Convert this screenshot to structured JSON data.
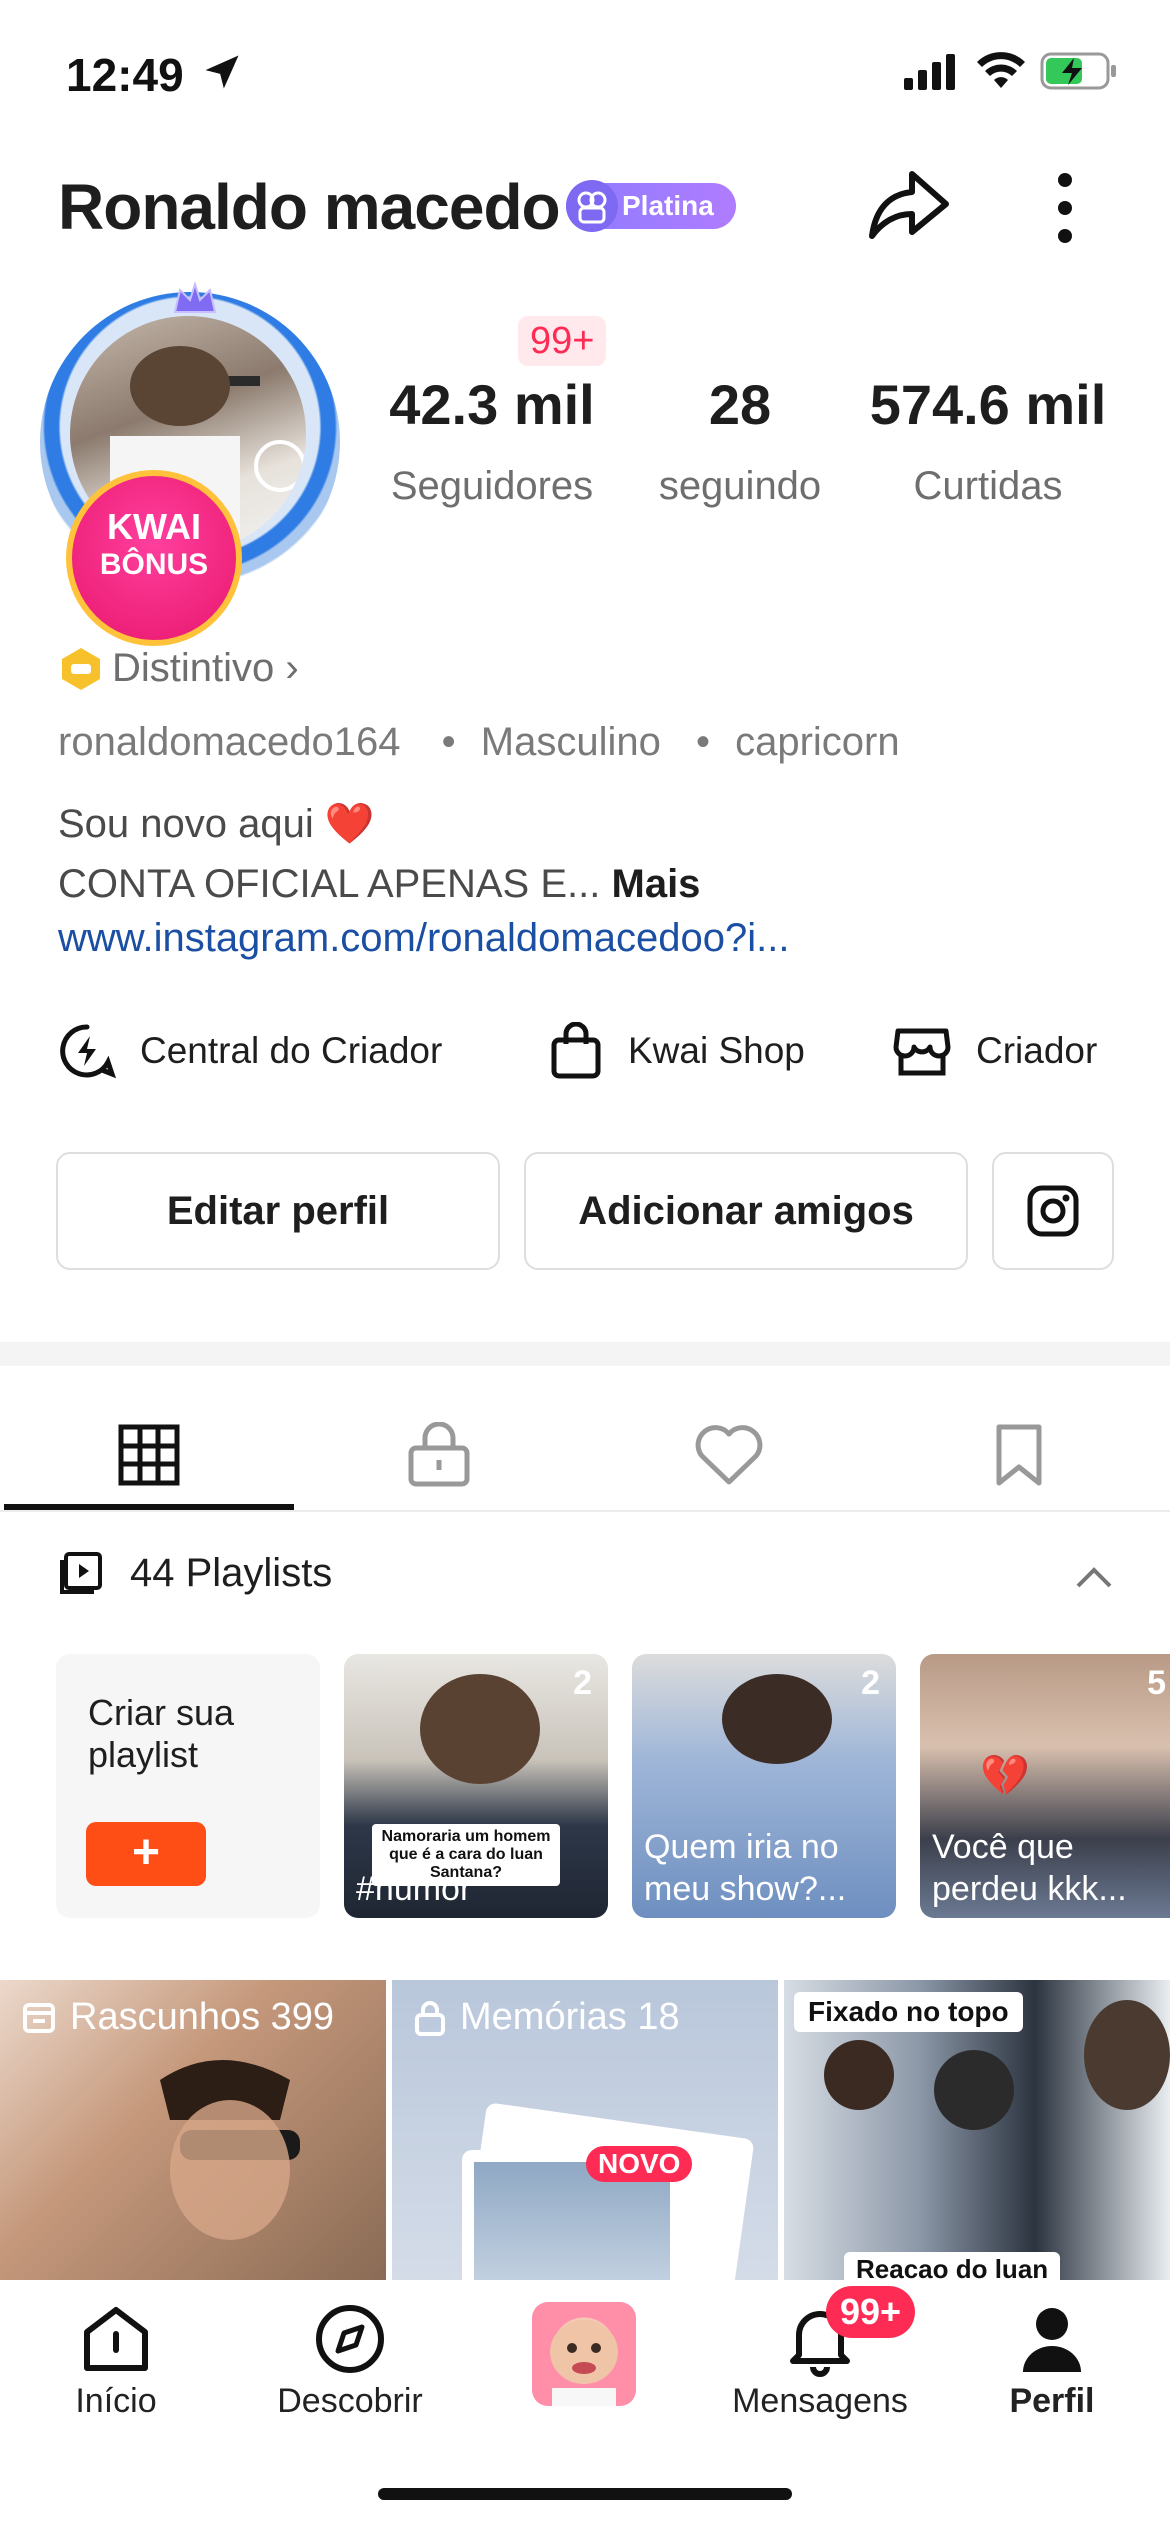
{
  "status_bar": {
    "time": "12:49"
  },
  "profile": {
    "name": "Ronaldo macedo",
    "badge": "Platina",
    "kwai_bonus": [
      "KWAI",
      "BÔNUS"
    ],
    "notification_badge": "99+",
    "stats": [
      {
        "value": "42.3 mil",
        "label": "Seguidores"
      },
      {
        "value": "28",
        "label": "seguindo"
      },
      {
        "value": "574.6 mil",
        "label": "Curtidas"
      }
    ],
    "distintivo": "Distintivo",
    "username": "ronaldomacedo164",
    "gender": "Masculino",
    "sign": "capricorn",
    "bio_line1": "Sou novo aqui ❤️",
    "bio_line2": "CONTA OFICIAL APENAS E...",
    "bio_more": "Mais",
    "link": "www.instagram.com/ronaldomacedoo?i..."
  },
  "tools": [
    "Central do Criador",
    "Kwai Shop",
    "Criador"
  ],
  "buttons": {
    "edit": "Editar perfil",
    "add_friends": "Adicionar amigos"
  },
  "playlists": {
    "title": "44 Playlists",
    "create_label": "Criar sua playlist",
    "items": [
      {
        "count": "2",
        "caption": "#humor",
        "overlay": "Namoraria um homem que é a cara do luan Santana?"
      },
      {
        "count": "2",
        "caption": "Quem iria no meu show?..."
      },
      {
        "count": "5",
        "caption": "Você que perdeu kkk..."
      }
    ]
  },
  "grid": {
    "drafts": "Rascunhos 399",
    "memories": "Memórias 18",
    "memories_badge": "NOVO",
    "pinned": "Fixado no topo",
    "pinned_caption": "Reacao do luan"
  },
  "bottom_nav": {
    "items": [
      "Início",
      "Descobrir",
      "",
      "Mensagens",
      "Perfil"
    ],
    "messages_badge": "99+"
  },
  "colors": {
    "accent_red": "#fe2c55",
    "orange": "#ff4d16",
    "link_blue": "#1b4fa3",
    "badge_purple": "#8d7bff"
  }
}
